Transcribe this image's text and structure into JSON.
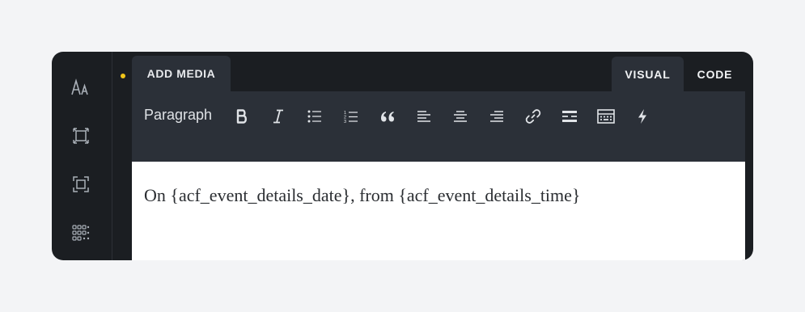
{
  "colors": {
    "accent_dot": "#f0c419",
    "panel_bg": "#1b1e22",
    "toolbar_bg": "#2b3038",
    "editor_bg": "#ffffff"
  },
  "sidebar": {
    "items": [
      {
        "icon": "typography-icon"
      },
      {
        "icon": "spacing-icon"
      },
      {
        "icon": "border-icon"
      },
      {
        "icon": "grid-dots-icon"
      }
    ]
  },
  "editor": {
    "add_media_label": "ADD MEDIA",
    "tabs": [
      {
        "label": "VISUAL",
        "active": true
      },
      {
        "label": "CODE",
        "active": false
      }
    ],
    "format_select": "Paragraph",
    "toolbar_icons": [
      "bold-icon",
      "italic-icon",
      "bulleted-list-icon",
      "numbered-list-icon",
      "blockquote-icon",
      "align-left-icon",
      "align-center-icon",
      "align-right-icon",
      "link-icon",
      "read-more-icon",
      "toolbar-toggle-icon",
      "dynamic-data-icon"
    ],
    "content": "On {acf_event_details_date}, from {acf_event_details_time}"
  }
}
